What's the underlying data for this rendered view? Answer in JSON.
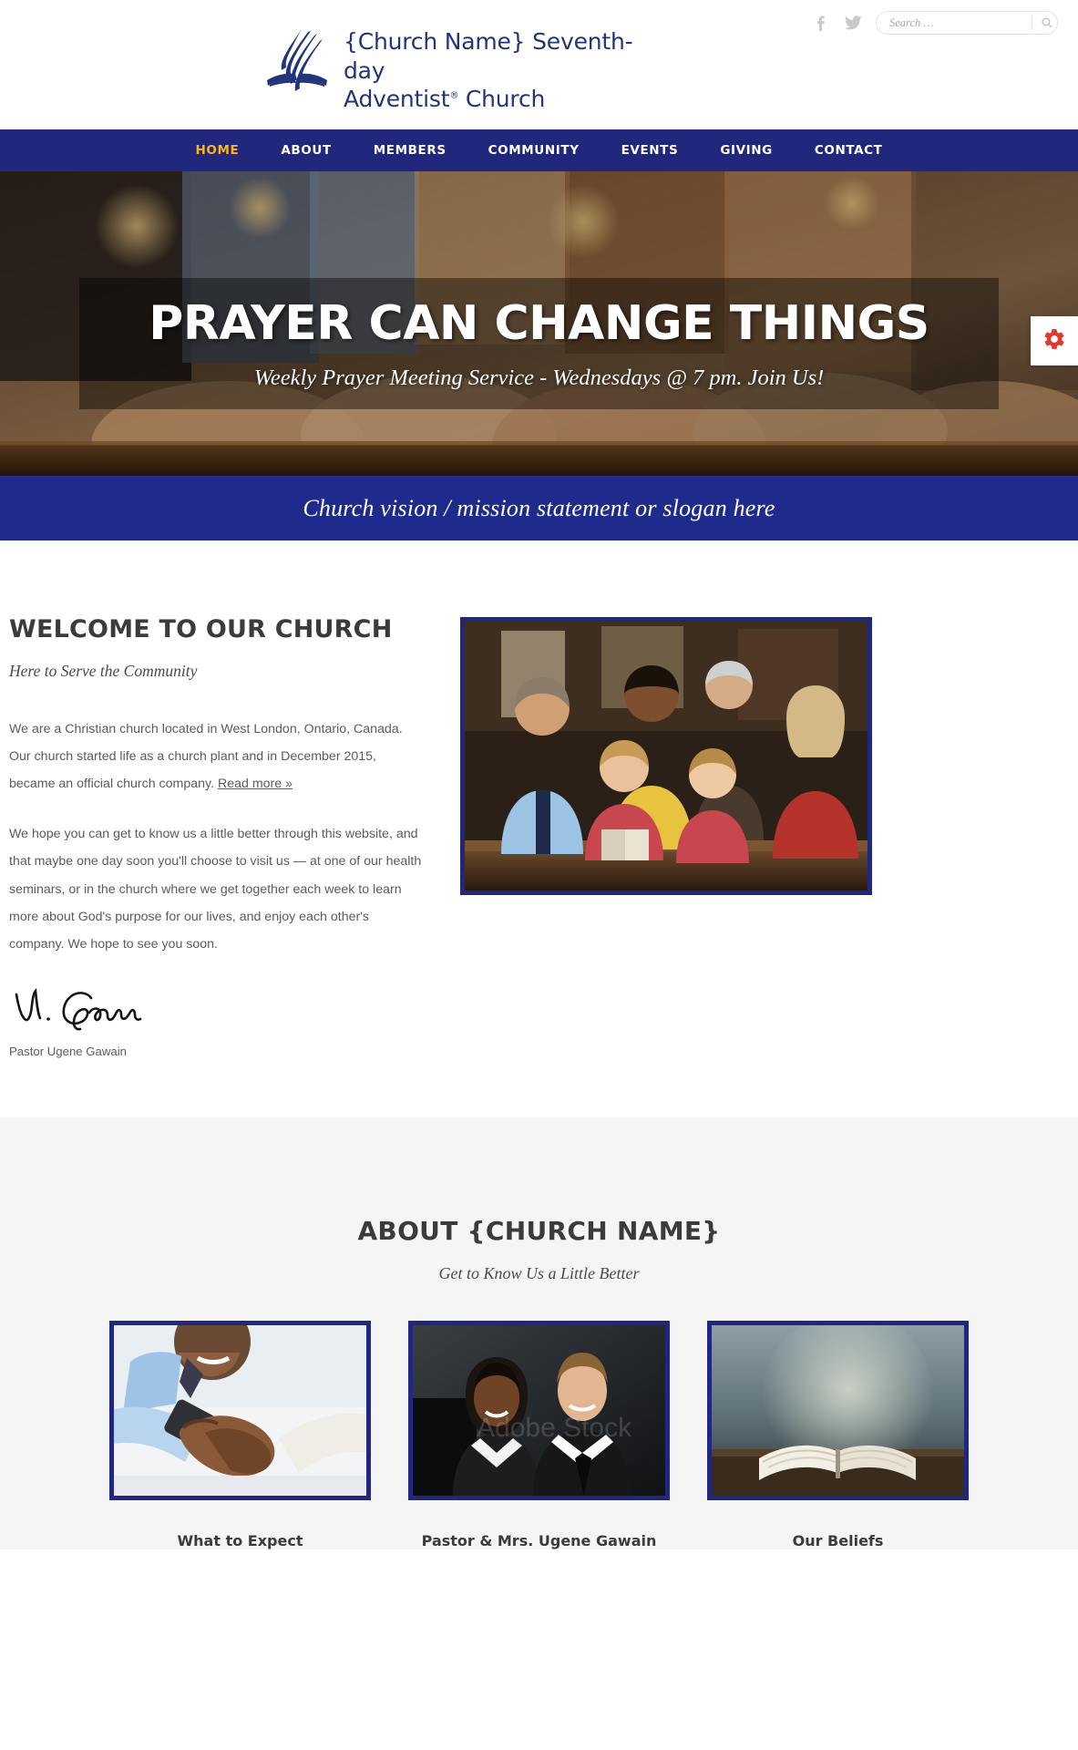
{
  "header": {
    "brand_line1": "{Church Name} Seventh-day",
    "brand_line2": "Adventist",
    "brand_line2_sup": "®",
    "brand_line2_tail": " Church",
    "logo_icon": "adventist-flame-logo",
    "social": [
      {
        "name": "facebook-icon",
        "label": "f"
      },
      {
        "name": "twitter-icon",
        "label": "t"
      }
    ],
    "search": {
      "placeholder": "Search …",
      "value": "",
      "button_icon": "search-icon"
    }
  },
  "nav": {
    "items": [
      {
        "label": "HOME",
        "active": true
      },
      {
        "label": "ABOUT",
        "active": false
      },
      {
        "label": "MEMBERS",
        "active": false
      },
      {
        "label": "COMMUNITY",
        "active": false
      },
      {
        "label": "EVENTS",
        "active": false
      },
      {
        "label": "GIVING",
        "active": false
      },
      {
        "label": "CONTACT",
        "active": false
      }
    ],
    "bg_color": "#20277d",
    "active_color": "#ffb41f"
  },
  "hero": {
    "title": "PRAYER CAN CHANGE THINGS",
    "subtitle": "Weekly Prayer Meeting Service - Wednesdays @ 7 pm. Join Us!",
    "image_alt": "people holding hands in prayer around a table",
    "settings_tab_icon": "gear-icon",
    "settings_tab_color": "#e03a2f"
  },
  "mission": {
    "text": "Church vision / mission statement or slogan here",
    "bg_color": "#1e2a8c"
  },
  "welcome": {
    "title": "WELCOME TO OUR CHURCH",
    "subtitle": "Here to Serve the Community",
    "paragraph1_before_link": "We are a Christian church located in West London, Ontario, Canada. Our church started life as a church plant and in December 2015, became an official church company. ",
    "paragraph1_link": "Read more »",
    "paragraph2": "We hope you can get to know us a little better through this website, and that maybe one day soon you'll choose to visit us — at one of our health seminars, or in the church where we get together each week to learn more about God's purpose for our lives, and enjoy each other's company. We hope to see you soon.",
    "signature_alt": "handwritten signature U. Gawain",
    "signature_name": "Pastor Ugene Gawain",
    "image_alt": "family reading a book together in church pews",
    "image_border_color": "#20277d"
  },
  "about": {
    "title": "ABOUT {CHURCH NAME}",
    "subtitle": "Get to Know Us a Little Better",
    "bg_color": "#f5f5f5",
    "cards": [
      {
        "caption": "What to Expect",
        "image_alt": "two people shaking hands"
      },
      {
        "caption": "Pastor & Mrs. Ugene Gawain",
        "image_alt": "portrait of a couple in business attire",
        "watermark": "Adobe Stock"
      },
      {
        "caption": "Our Beliefs",
        "image_alt": "open bible on a wooden table at dusk"
      }
    ]
  }
}
